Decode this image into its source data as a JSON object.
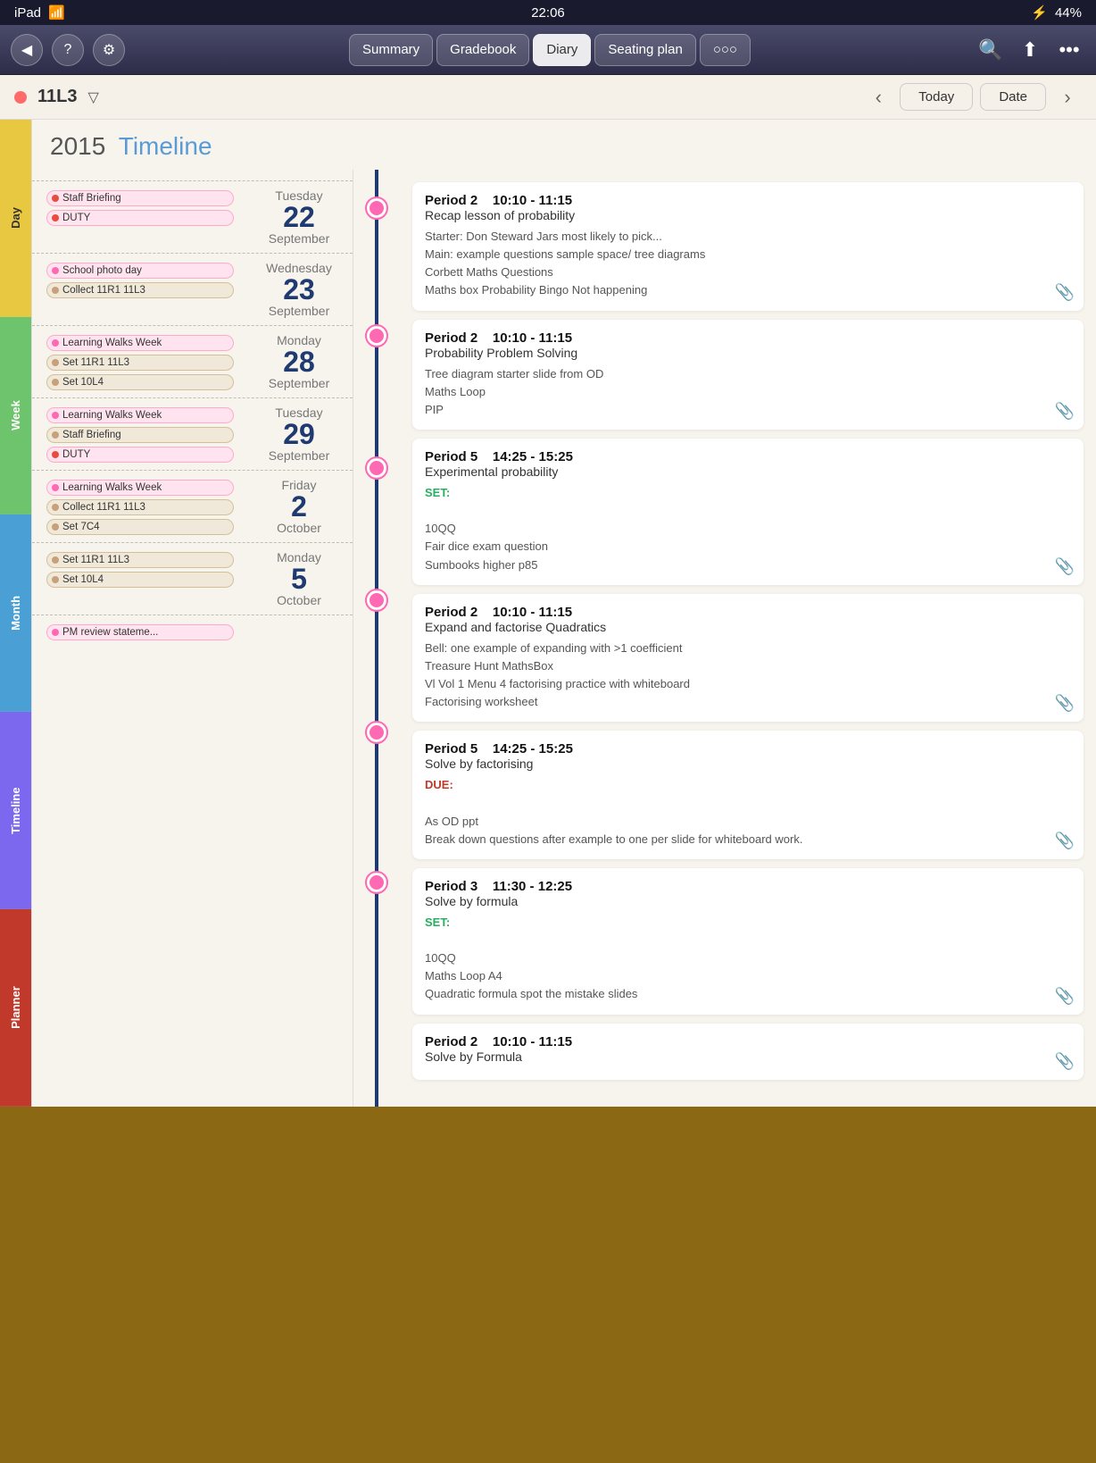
{
  "statusBar": {
    "left": "iPad",
    "wifi": "wifi-icon",
    "time": "22:06",
    "bluetooth": "bluetooth-icon",
    "battery": "44%"
  },
  "topNav": {
    "backBtn": "◀",
    "helpBtn": "?",
    "settingsBtn": "⚙",
    "tabs": [
      "Summary",
      "Gradebook",
      "Diary",
      "Seating plan",
      "○○○"
    ],
    "activeTab": "Diary",
    "searchBtn": "🔍",
    "uploadBtn": "⬆",
    "moreBtn": "•••"
  },
  "classBar": {
    "className": "11L3",
    "dropdownIcon": "▽",
    "prevBtn": "‹",
    "todayBtn": "Today",
    "dateBtn": "Date",
    "nextBtn": "›"
  },
  "sideTabs": [
    "Day",
    "Week",
    "Month",
    "Timeline",
    "Planner"
  ],
  "timelineHeader": {
    "year": "2015",
    "word": "Timeline"
  },
  "sections": [
    {
      "id": "sep22",
      "tags": [
        {
          "type": "pink",
          "dot": "red",
          "label": "Staff Briefing"
        },
        {
          "type": "pink",
          "dot": "red",
          "label": "DUTY"
        }
      ],
      "dayName": "Tuesday",
      "dayNum": "22",
      "monthName": "September",
      "lessons": [
        {
          "period": "Period 2   10:10 - 11:15",
          "title": "Recap lesson of probability",
          "body": "Starter: Don Steward Jars most likely to pick...\nMain: example questions sample space/ tree diagrams\nCorbett Maths Questions\nMaths box Probability Bingo Not happening",
          "clip": true
        },
        {
          "period": "Period 2   10:10 - 11:15",
          "title": "Probability Problem Solving",
          "body": "Tree diagram starter slide from OD\nMaths Loop\nPIP",
          "clip": true
        }
      ]
    },
    {
      "id": "sep23",
      "tags": [
        {
          "type": "pink",
          "dot": "pink",
          "label": "School photo day"
        },
        {
          "type": "tan",
          "dot": "tan",
          "label": "Collect 11R1 11L3"
        }
      ],
      "dayName": "Wednesday",
      "dayNum": "23",
      "monthName": "September",
      "lessons": [
        {
          "period": "Period 5   14:25 - 15:25",
          "title": "Experimental probability",
          "body": "SET:\n\n10QQ\nFair dice exam question\nSumbooks higher p85",
          "clip": true,
          "setLabel": true
        }
      ]
    },
    {
      "id": "sep28",
      "tags": [
        {
          "type": "pink",
          "dot": "pink",
          "label": "Learning Walks Week"
        },
        {
          "type": "tan",
          "dot": "tan",
          "label": "Set 11R1 11L3"
        },
        {
          "type": "tan",
          "dot": "tan",
          "label": "Set 10L4"
        }
      ],
      "dayName": "Monday",
      "dayNum": "28",
      "monthName": "September",
      "lessons": [
        {
          "period": "Period 2   10:10 - 11:15",
          "title": "Expand and factorise Quadratics",
          "body": "Bell: one example of expanding with >1 coefficient\nTreasure Hunt MathsBox\nVl Vol 1 Menu 4 factorising practice with whiteboard\nFactorising worksheet",
          "clip": true
        }
      ]
    },
    {
      "id": "sep29",
      "tags": [
        {
          "type": "pink",
          "dot": "pink",
          "label": "Learning Walks Week"
        },
        {
          "type": "tan",
          "dot": "tan",
          "label": "Staff Briefing"
        },
        {
          "type": "pink",
          "dot": "red",
          "label": "DUTY"
        }
      ],
      "dayName": "Tuesday",
      "dayNum": "29",
      "monthName": "September",
      "lessons": []
    },
    {
      "id": "oct2",
      "tags": [
        {
          "type": "pink",
          "dot": "pink",
          "label": "Learning Walks Week"
        },
        {
          "type": "tan",
          "dot": "tan",
          "label": "Collect 11R1 11L3"
        },
        {
          "type": "tan",
          "dot": "tan",
          "label": "Set 7C4"
        }
      ],
      "dayName": "Friday",
      "dayNum": "2",
      "monthName": "October",
      "lessons": [
        {
          "period": "Period 5   14:25 - 15:25",
          "title": "Solve by factorising",
          "body": "DUE:\n\nAs OD ppt\nBreak down questions after example to one per slide for whiteboard work.",
          "dueLabel": true,
          "clip": true
        },
        {
          "period": "Period 3   11:30 - 12:25",
          "title": "Solve by formula",
          "body": "SET:\n\n10QQ\nMaths Loop A4\nQuadratic formula spot the mistake slides",
          "setLabel": true,
          "clip": true
        }
      ]
    },
    {
      "id": "oct5",
      "tags": [
        {
          "type": "tan",
          "dot": "tan",
          "label": "Set 11R1 11L3"
        },
        {
          "type": "tan",
          "dot": "tan",
          "label": "Set 10L4"
        }
      ],
      "dayName": "Monday",
      "dayNum": "5",
      "monthName": "October",
      "lessons": [
        {
          "period": "Period 2   10:10 - 11:15",
          "title": "Solve by Formula",
          "body": "",
          "clip": true
        }
      ]
    },
    {
      "id": "oct_last",
      "tags": [
        {
          "type": "pink",
          "dot": "pink",
          "label": "PM review stateme..."
        }
      ],
      "dayName": "",
      "dayNum": "",
      "monthName": "",
      "lessons": []
    }
  ]
}
